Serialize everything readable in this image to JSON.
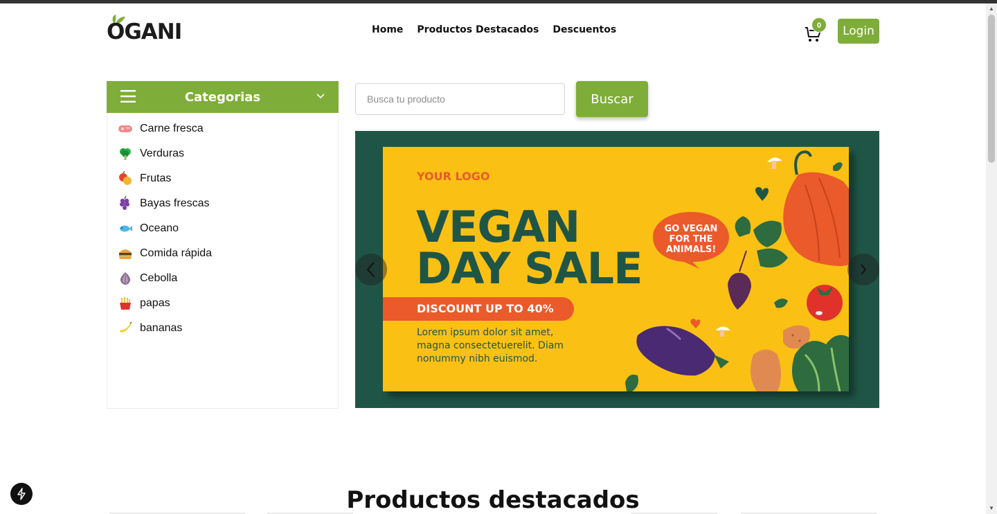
{
  "header": {
    "logo_text": "OGANI",
    "nav": [
      "Home",
      "Productos Destacados",
      "Descuentos"
    ],
    "cart_count": "0",
    "login_label": "Login"
  },
  "categories": {
    "title": "Categorias",
    "items": [
      {
        "label": "Carne fresca",
        "icon": "meat-icon"
      },
      {
        "label": "Verduras",
        "icon": "broccoli-icon"
      },
      {
        "label": "Frutas",
        "icon": "fruits-icon"
      },
      {
        "label": "Bayas frescas",
        "icon": "grapes-icon"
      },
      {
        "label": "Oceano",
        "icon": "fish-icon"
      },
      {
        "label": "Comida rápida",
        "icon": "burger-icon"
      },
      {
        "label": "Cebolla",
        "icon": "onion-icon"
      },
      {
        "label": "papas",
        "icon": "fries-icon"
      },
      {
        "label": "bananas",
        "icon": "banana-icon"
      }
    ]
  },
  "search": {
    "placeholder": "Busca tu producto",
    "button_label": "Buscar"
  },
  "banner": {
    "logo": "YOUR LOGO",
    "title_line1": "VEGAN",
    "title_line2": "DAY SALE",
    "discount": "DISCOUNT UP TO 40%",
    "body_line1": "Lorem ipsum dolor sit amet,",
    "body_line2": "magna consectetuerelit. Diam",
    "body_line3": "nonummy nibh euismod.",
    "bubble_line1": "GO VEGAN",
    "bubble_line2": "FOR THE",
    "bubble_line3": "ANIMALS!"
  },
  "section": {
    "title": "Productos destacados"
  },
  "colors": {
    "accent": "#7fad39",
    "banner_bg": "#1f5546",
    "banner_card": "#fbc014",
    "banner_orange": "#ea5a2a"
  }
}
